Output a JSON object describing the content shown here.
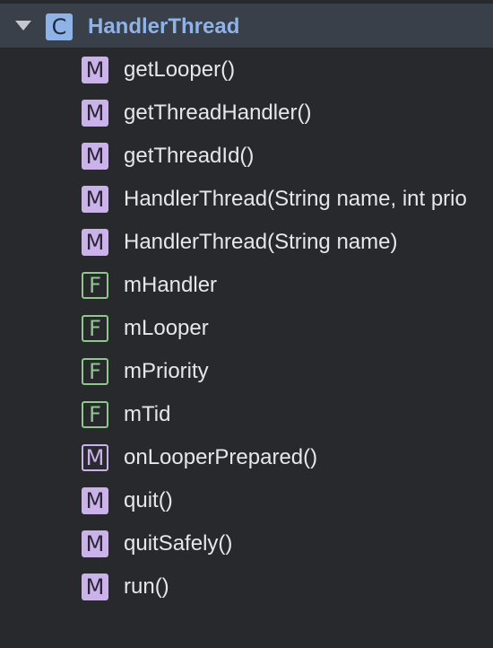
{
  "class_node": {
    "badge": "C",
    "title": "HandlerThread"
  },
  "members": [
    {
      "badge": "M",
      "kind": "method",
      "label": "getLooper()"
    },
    {
      "badge": "M",
      "kind": "method",
      "label": "getThreadHandler()"
    },
    {
      "badge": "M",
      "kind": "method",
      "label": "getThreadId()"
    },
    {
      "badge": "M",
      "kind": "method",
      "label": "HandlerThread(String name, int prio"
    },
    {
      "badge": "M",
      "kind": "method",
      "label": "HandlerThread(String name)"
    },
    {
      "badge": "F",
      "kind": "field",
      "label": "mHandler"
    },
    {
      "badge": "F",
      "kind": "field",
      "label": "mLooper"
    },
    {
      "badge": "F",
      "kind": "field",
      "label": "mPriority"
    },
    {
      "badge": "F",
      "kind": "field",
      "label": "mTid"
    },
    {
      "badge": "M",
      "kind": "method-outline",
      "label": "onLooperPrepared()"
    },
    {
      "badge": "M",
      "kind": "method",
      "label": "quit()"
    },
    {
      "badge": "M",
      "kind": "method",
      "label": "quitSafely()"
    },
    {
      "badge": "M",
      "kind": "method",
      "label": "run()"
    }
  ],
  "colors": {
    "background": "#27292c",
    "selected_row": "#3a4049",
    "class_accent": "#8fb3e6",
    "method_badge": "#c9b3e8",
    "field_badge": "#8fc78f",
    "text": "#e6e7e8"
  },
  "icons": {
    "expand": "triangle-down-icon"
  }
}
